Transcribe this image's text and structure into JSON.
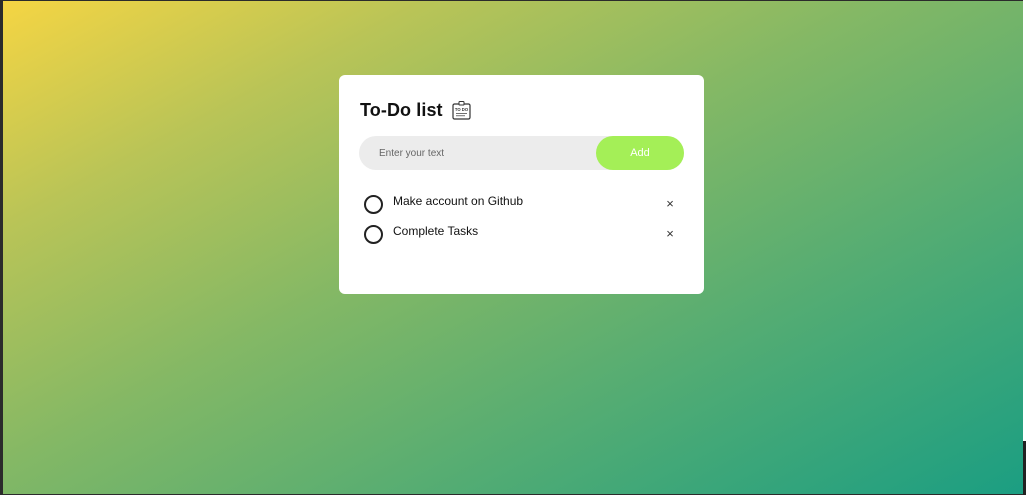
{
  "app": {
    "title": "To-Do list",
    "title_icon": "todo-list-icon"
  },
  "input": {
    "placeholder": "Enter your text",
    "value": ""
  },
  "buttons": {
    "add_label": "Add"
  },
  "tasks": [
    {
      "text": "Make account on Github",
      "completed": false,
      "delete_label": "×"
    },
    {
      "text": "Complete Tasks",
      "completed": false,
      "delete_label": "×"
    }
  ],
  "colors": {
    "accent": "#a4ef57",
    "gradient_start": "#f5d543",
    "gradient_end": "#1b9e82",
    "card": "#ffffff",
    "input_bg": "#ececec"
  }
}
